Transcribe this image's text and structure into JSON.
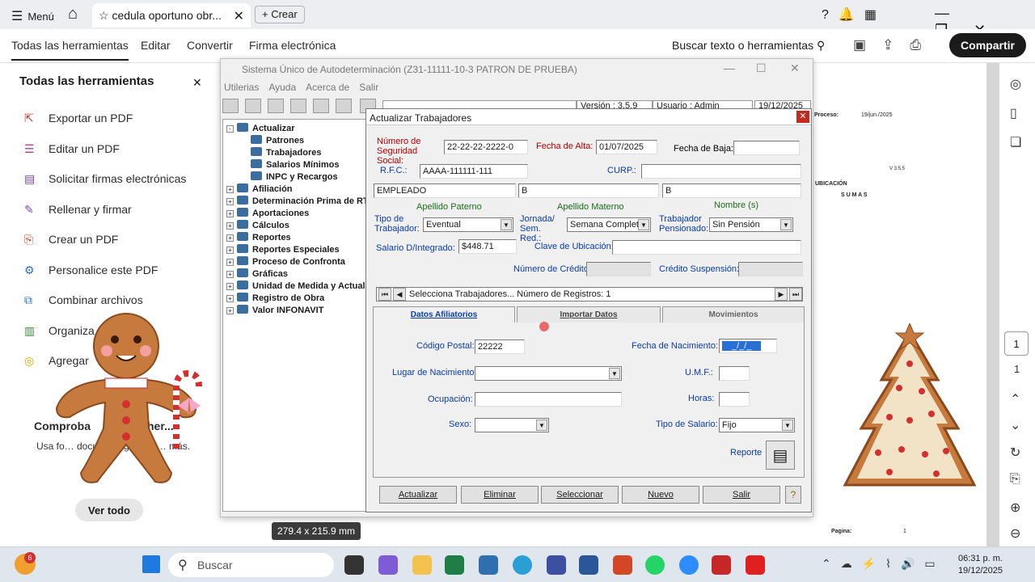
{
  "browser": {
    "menu_label": "Menú",
    "tab_title": "cedula oportuno obr...",
    "new_tab_label": "Crear"
  },
  "toolbar": {
    "all_tools": "Todas las herramientas",
    "edit": "Editar",
    "convert": "Convertir",
    "esign": "Firma electrónica",
    "search": "Buscar texto o herramientas",
    "share": "Compartir"
  },
  "leftpanel": {
    "title": "Todas las herramientas",
    "items": [
      {
        "label": "Exportar un PDF",
        "icon": "export-pdf-icon"
      },
      {
        "label": "Editar un PDF",
        "icon": "edit-pdf-icon"
      },
      {
        "label": "Solicitar firmas electrónicas",
        "icon": "request-signature-icon"
      },
      {
        "label": "Rellenar y firmar",
        "icon": "fill-sign-icon"
      },
      {
        "label": "Crear un PDF",
        "icon": "create-pdf-icon"
      },
      {
        "label": "Personalice este PDF",
        "icon": "customize-pdf-icon"
      },
      {
        "label": "Combinar archivos",
        "icon": "combine-files-icon"
      },
      {
        "label": "Organiza",
        "icon": "organize-icon"
      },
      {
        "label": "Agregar",
        "icon": "add-comment-icon"
      }
    ],
    "promo_title": "Comproba",
    "promo_title_tail": "her...",
    "promo_text": "Usa fo… docum… agrega p… más.",
    "see_all": "Ver todo"
  },
  "app": {
    "title": "Sistema Único de Autodeterminación (Z31-11111-10-3  PATRON DE PRUEBA)",
    "menu": [
      "Utilerias",
      "Ayuda",
      "Acerca de",
      "Salir"
    ],
    "version": "Versión : 3.5.9",
    "user": "Usuario : Admin",
    "date": "19/12/2025",
    "tree": [
      {
        "label": "Actualizar",
        "indent": 0,
        "expand": "-"
      },
      {
        "label": "Patrones",
        "indent": 1,
        "expand": ""
      },
      {
        "label": "Trabajadores",
        "indent": 1,
        "expand": ""
      },
      {
        "label": "Salarios Mínimos",
        "indent": 1,
        "expand": ""
      },
      {
        "label": "INPC y Recargos",
        "indent": 1,
        "expand": ""
      },
      {
        "label": "Afiliación",
        "indent": 0,
        "expand": "+"
      },
      {
        "label": "Determinación Prima de RT",
        "indent": 0,
        "expand": "+"
      },
      {
        "label": "Aportaciones",
        "indent": 0,
        "expand": "+"
      },
      {
        "label": "Cálculos",
        "indent": 0,
        "expand": "+"
      },
      {
        "label": "Reportes",
        "indent": 0,
        "expand": "+"
      },
      {
        "label": "Reportes Especiales",
        "indent": 0,
        "expand": "+"
      },
      {
        "label": "Proceso de Confronta",
        "indent": 0,
        "expand": "+"
      },
      {
        "label": "Gráficas",
        "indent": 0,
        "expand": "+"
      },
      {
        "label": "Unidad de Medida y Actuali",
        "indent": 0,
        "expand": "+"
      },
      {
        "label": "Registro de Obra",
        "indent": 0,
        "expand": "+"
      },
      {
        "label": "Valor INFONAVIT",
        "indent": 0,
        "expand": "+"
      }
    ]
  },
  "dialog": {
    "title": "Actualizar Trabajadores",
    "nss_label": "Número de Seguridad Social:",
    "nss_value": "22-22-22-2222-0",
    "alta_label": "Fecha de Alta:",
    "alta_value": "01/07/2025",
    "baja_label": "Fecha de Baja:",
    "baja_value": "",
    "rfc_label": "R.F.C.:",
    "rfc_value": "AAAA-111111-111",
    "curp_label": "CURP.:",
    "curp_value": "",
    "apellido_paterno": "EMPLEADO",
    "apellido_materno": "B",
    "nombre": "B",
    "lbl_ap_paterno": "Apellido Paterno",
    "lbl_ap_materno": "Apellido Materno",
    "lbl_nombre": "Nombre (s)",
    "tipo_trab_label": "Tipo de Trabajador:",
    "tipo_trab_value": "Eventual",
    "jornada_label": "Jornada/ Sem. Red.:",
    "jornada_value": "Semana Completa",
    "pensionado_label": "Trabajador Pensionado:",
    "pensionado_value": "Sin Pensión",
    "salario_label": "Salario D/Integrado:",
    "salario_value": "$448.71",
    "ubicacion_label": "Clave de Ubicación:",
    "credito_label": "Número de Crédito:",
    "suspension_label": "Crédito Suspensión:",
    "nav_text": "Selecciona Trabajadores... Número de Registros: 1",
    "tabs": [
      "Datos Afiliatorios",
      "Importar Datos",
      "Movimientos"
    ],
    "cp_label": "Código Postal:",
    "cp_value": "22222",
    "fnac_label": "Fecha de Nacimiento:",
    "fnac_value": "_/_/_",
    "lugar_label": "Lugar de Nacimiento:",
    "umf_label": "U.M.F.:",
    "ocupacion_label": "Ocupación:",
    "horas_label": "Horas:",
    "sexo_label": "Sexo:",
    "tipo_salario_label": "Tipo de Salario:",
    "tipo_salario_value": "Fijo",
    "reporte_label": "Reporte",
    "buttons": [
      "Actualizar",
      "Eliminar",
      "Seleccionar",
      "Nuevo",
      "Salir"
    ]
  },
  "docfrag": {
    "proceso": "Proceso:",
    "proceso_fecha": "19/jun./2025",
    "ubicacion": "UBICACIÓN",
    "sumas": "S U M A S",
    "version": "V 3.5.5",
    "pagina": "Pagina:",
    "pagina_num": "1"
  },
  "pagecounter": {
    "current": "1",
    "total": "1"
  },
  "dimension_tip": "279.4 x 215.9 mm",
  "taskbar": {
    "search": "Buscar",
    "time": "06:31 p. m.",
    "date": "19/12/2025",
    "badge": "6"
  }
}
